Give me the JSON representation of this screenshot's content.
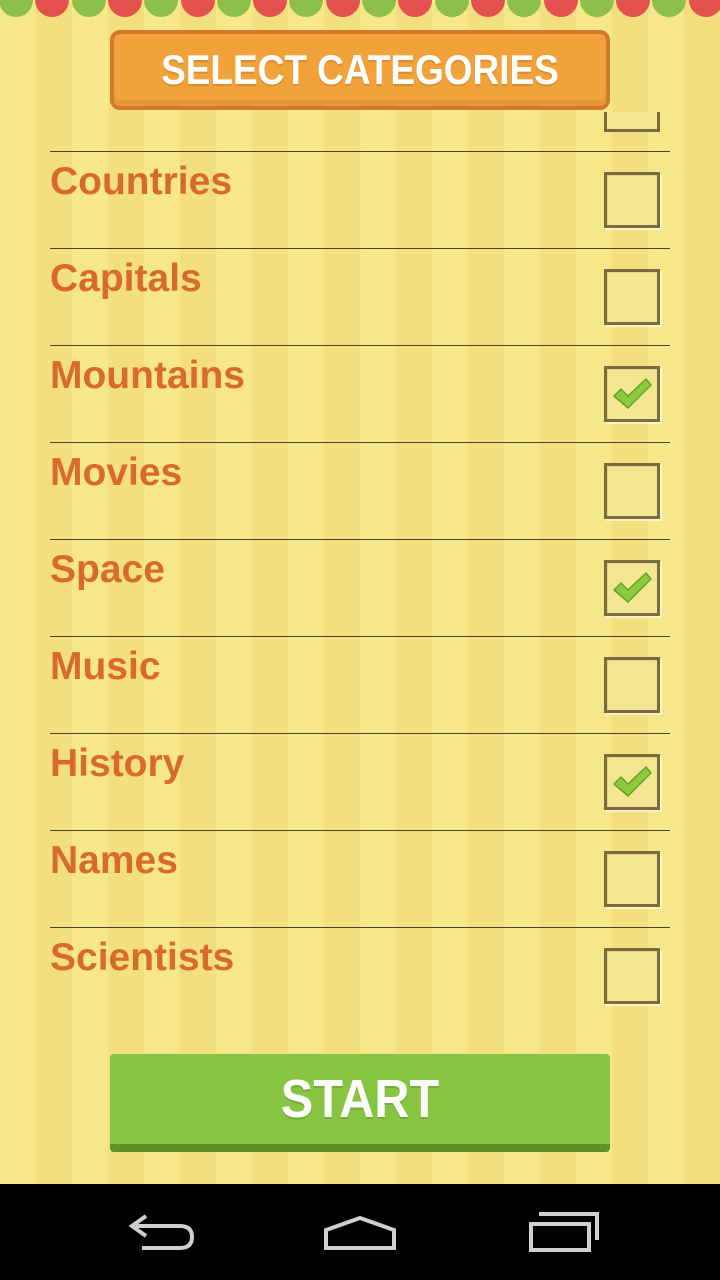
{
  "colors": {
    "background": "#f6e88a",
    "header_button": "#f2a23a",
    "label_text": "#d96a2e",
    "start_button": "#86c442",
    "check_mark": "#8bc93f",
    "scallop_red": "#e45250",
    "scallop_green": "#8cc04a"
  },
  "header": {
    "title": "SELECT CATEGORIES"
  },
  "categories": [
    {
      "label": "Countries",
      "checked": false
    },
    {
      "label": "Capitals",
      "checked": false
    },
    {
      "label": "Mountains",
      "checked": true
    },
    {
      "label": "Movies",
      "checked": false
    },
    {
      "label": "Space",
      "checked": true
    },
    {
      "label": "Music",
      "checked": false
    },
    {
      "label": "History",
      "checked": true
    },
    {
      "label": "Names",
      "checked": false
    },
    {
      "label": "Scientists",
      "checked": false
    }
  ],
  "start_button": {
    "label": "START"
  },
  "navigation": {
    "back_icon": "back-arrow-icon",
    "home_icon": "home-icon",
    "recents_icon": "recent-apps-icon"
  }
}
